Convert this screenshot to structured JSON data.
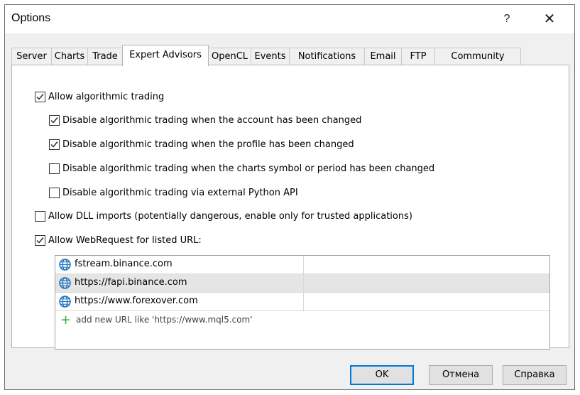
{
  "window": {
    "title": "Options",
    "help_glyph": "?",
    "close_glyph": "✕"
  },
  "tabs": [
    {
      "label": "Server",
      "active": false
    },
    {
      "label": "Charts",
      "active": false
    },
    {
      "label": "Trade",
      "active": false
    },
    {
      "label": "Expert Advisors",
      "active": true
    },
    {
      "label": "OpenCL",
      "active": false
    },
    {
      "label": "Events",
      "active": false
    },
    {
      "label": "Notifications",
      "active": false
    },
    {
      "label": "Email",
      "active": false
    },
    {
      "label": "FTP",
      "active": false
    },
    {
      "label": "Community",
      "active": false
    }
  ],
  "options": {
    "allow_algo": {
      "label": "Allow algorithmic trading",
      "checked": true
    },
    "disable_account": {
      "label": "Disable algorithmic trading when the account has been changed",
      "checked": true
    },
    "disable_profile": {
      "label": "Disable algorithmic trading when the profile has been changed",
      "checked": true
    },
    "disable_symbol": {
      "label": "Disable algorithmic trading when the charts symbol or period has been changed",
      "checked": false
    },
    "disable_python": {
      "label": "Disable algorithmic trading via external Python API",
      "checked": false
    },
    "allow_dll": {
      "label": "Allow DLL imports (potentially dangerous, enable only for trusted applications)",
      "checked": false
    },
    "allow_webrequest": {
      "label": "Allow WebRequest for listed URL:",
      "checked": true
    }
  },
  "url_list": {
    "urls": [
      {
        "url": "fstream.binance.com",
        "icon": "globe-icon",
        "selected": false
      },
      {
        "url": "https://fapi.binance.com",
        "icon": "globe-icon",
        "selected": true
      },
      {
        "url": "https://www.forexover.com",
        "icon": "globe-icon",
        "selected": false
      }
    ],
    "add_label": "add new URL like 'https://www.mql5.com'",
    "add_icon": "plus-icon"
  },
  "buttons": {
    "ok": "OK",
    "cancel": "Отмена",
    "help": "Справка"
  },
  "colors": {
    "accent": "#0078d7",
    "globe": "#1e73be",
    "plus": "#2ea83a",
    "selected_row": "#e5e5e5"
  }
}
